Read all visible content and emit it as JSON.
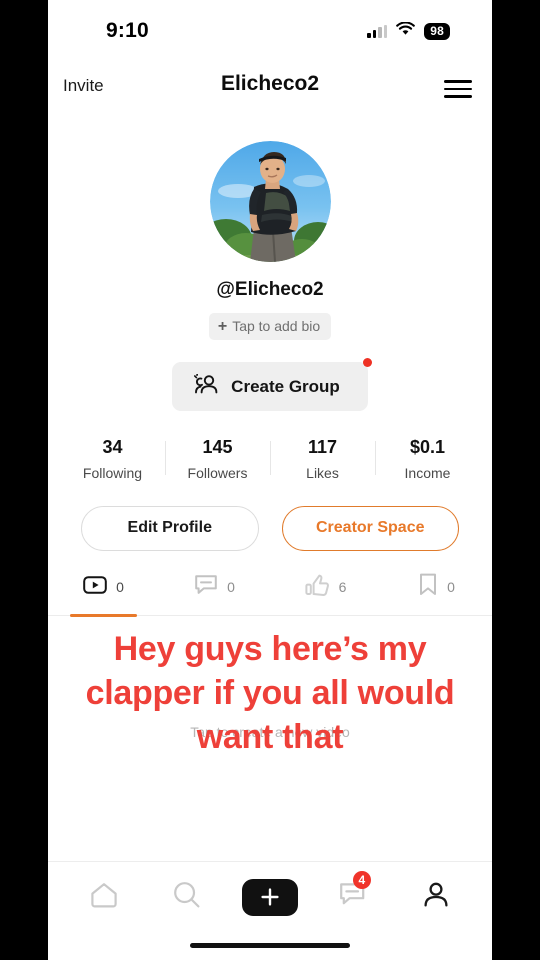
{
  "status_bar": {
    "time": "9:10",
    "battery": "98",
    "signal_icon": "cellular-signal-icon",
    "wifi_icon": "wifi-icon",
    "battery_icon": "battery-icon"
  },
  "header": {
    "invite_label": "Invite",
    "title": "Elicheco2",
    "menu_icon": "hamburger-menu-icon"
  },
  "profile": {
    "avatar_alt": "user-avatar-photo",
    "handle": "@Elicheco2",
    "bio_placeholder": "Tap to add bio",
    "bio_plus": "+",
    "create_group": {
      "label": "Create Group",
      "icon": "people-group-icon",
      "has_notification_dot": true
    }
  },
  "stats": [
    {
      "value": "34",
      "label": "Following"
    },
    {
      "value": "145",
      "label": "Followers"
    },
    {
      "value": "117",
      "label": "Likes"
    },
    {
      "value": "$0.1",
      "label": "Income"
    }
  ],
  "actions": {
    "edit_profile": "Edit Profile",
    "creator_space": "Creator Space"
  },
  "content_tabs": [
    {
      "icon": "video-play-icon",
      "count": "0",
      "active": true
    },
    {
      "icon": "comment-bubble-icon",
      "count": "0",
      "active": false
    },
    {
      "icon": "thumbs-up-icon",
      "count": "6",
      "active": false
    },
    {
      "icon": "bookmark-icon",
      "count": "0",
      "active": false
    }
  ],
  "empty_state": {
    "hint": "Tap to create a new video"
  },
  "annotation": {
    "text": "Hey guys here’s my clapper if you all would want that"
  },
  "bottom_nav": {
    "items": [
      {
        "icon": "home-icon",
        "label": "Home"
      },
      {
        "icon": "search-icon",
        "label": "Search"
      },
      {
        "icon": "plus-icon",
        "label": "Create"
      },
      {
        "icon": "chat-icon",
        "label": "Messages",
        "badge": "4"
      },
      {
        "icon": "person-icon",
        "label": "Profile"
      }
    ]
  },
  "colors": {
    "accent_orange": "#e8792a",
    "annotation_red": "#ee4039",
    "badge_red": "#f0342a",
    "notification_dot": "#ee3124",
    "compose_black": "#111111"
  }
}
